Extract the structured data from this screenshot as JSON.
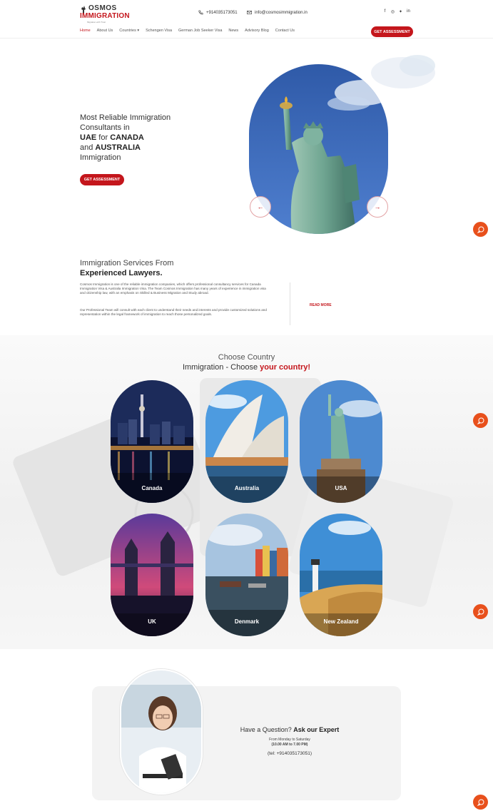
{
  "header": {
    "logo_word1": "OSMOS",
    "logo_word2": "IMMIGRATION",
    "logo_tagline": "Migration with Trust",
    "phone": "+914035173051",
    "email": "info@cosmosimmigration.in",
    "socials": [
      "facebook-icon",
      "instagram-icon",
      "twitter-icon",
      "linkedin-icon"
    ],
    "nav": [
      {
        "label": "Home",
        "active": true
      },
      {
        "label": "About Us"
      },
      {
        "label": "Countries ▾"
      },
      {
        "label": "Schengen Visa"
      },
      {
        "label": "German Job Seeker Visa"
      },
      {
        "label": "News"
      },
      {
        "label": "Advisory Blog"
      },
      {
        "label": "Contact Us"
      }
    ],
    "cta": "GET ASSESSMENT"
  },
  "hero": {
    "line1": "Most Reliable Immigration",
    "line2": "Consultants in",
    "line3a": "UAE",
    "line3b": " for ",
    "line3c": "CANADA",
    "line4a": "and ",
    "line4b": "AUSTRALIA",
    "line5": "Immigration",
    "cta": "GET ASSESSMENT",
    "prev": "←",
    "next": "→"
  },
  "about": {
    "title1": "Immigration Services From",
    "title2": "Experienced Lawyers.",
    "para1": "Cosmos Immigration is one of the reliable immigration companies, which offers professional consultancy services for Canada Immigration Visa & Australia Immigration Visa. The Team Cosmos Immigration has many years of experience in immigration visa and citizenship law, with an emphasis on Skilled & Business Migration and Study abroad.",
    "para2": "Our Professional Team will consult with each client to understand their needs and interests and provide customized solutions and representation within the legal framework of immigration to reach those personalized goals.",
    "read_more": "READ MORE"
  },
  "countries": {
    "title1": "Choose Country",
    "title2a": "Immigration - Choose ",
    "title2b": "your country!",
    "items": [
      "Canada",
      "Australia",
      "USA",
      "UK",
      "Denmark",
      "New Zealand"
    ]
  },
  "expert": {
    "title_a": "Have a Question? ",
    "title_b": "Ask our Expert",
    "days": "From Monday to Saturday",
    "hours": "(10.00 AM to 7.00 PM)",
    "tel": "(tel: +914035173051)"
  },
  "colors": {
    "brand_red": "#c4161c",
    "fab_orange": "#e8501c"
  }
}
